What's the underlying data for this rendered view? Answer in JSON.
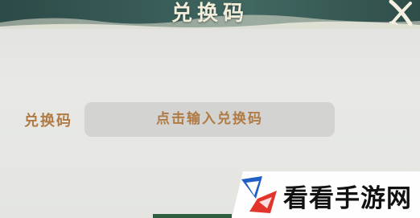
{
  "dialog": {
    "title": "兑换码",
    "close_icon": "close-x-icon"
  },
  "form": {
    "label": "兑换码",
    "input_placeholder": "点击输入兑换码",
    "input_value": ""
  },
  "watermark": {
    "site_name": "看看手游网",
    "logo_icon": "kankan-logo-icon"
  },
  "colors": {
    "header": "#3a5e59",
    "title_text": "#f3eedb",
    "label_text": "#b07a44",
    "input_bg": "#d3d4d1",
    "body_bg": "#e6e7e4"
  }
}
